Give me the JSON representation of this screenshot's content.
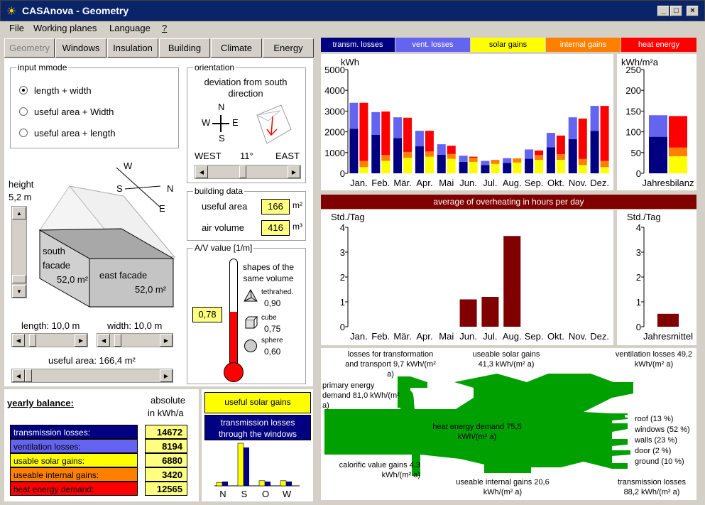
{
  "window": {
    "title": "CASAnova - Geometry",
    "min": "_",
    "max": "□",
    "close": "×"
  },
  "menu": [
    "File",
    "Working planes",
    "Language",
    "?"
  ],
  "tabs": [
    "Geometry",
    "Windows",
    "Insulation",
    "Building",
    "Climate",
    "Energy"
  ],
  "input_mode": {
    "title": "input mmode",
    "options": [
      "length + width",
      "useful area + Width",
      "useful area + length"
    ],
    "selected": 0
  },
  "orientation": {
    "title": "orientation",
    "desc": "deviation from south direction",
    "compass": {
      "n": "N",
      "w": "W",
      "e": "E",
      "s": "S"
    },
    "west": "WEST",
    "deg": "11°",
    "east": "EAST"
  },
  "building_data": {
    "title": "building data",
    "useful_area_label": "useful area",
    "useful_area": "166",
    "air_volume_label": "air volume",
    "air_volume": "416",
    "unit_area": "m²",
    "unit_volume": "m³"
  },
  "av": {
    "title": "A/V value [1/m]",
    "value": "0,78",
    "fill": 0.53,
    "shapes_label": "shapes of the same volume",
    "tetra": "tethrahed.",
    "tetra_v": "0,90",
    "cube": "cube",
    "cube_v": "0,75",
    "sphere": "sphere",
    "sphere_v": "0,60"
  },
  "geometry": {
    "height_label": "height",
    "height": "5,2 m",
    "south": "south",
    "facade": "facade",
    "south_area": "52,0 m²",
    "east": "east facade",
    "east_area": "52,0 m²",
    "compass": {
      "w": "W",
      "s": "S",
      "n": "N",
      "e": "E"
    },
    "length": "length: 10,0 m",
    "width": "width: 10,0 m",
    "useful_area": "useful area: 166,4 m²"
  },
  "yearly": {
    "title": "yearly balance:",
    "unit1": "absolute",
    "unit2": "in kWh/a",
    "rows": [
      {
        "label": "transmission losses:",
        "value": "14672",
        "color": "#000080",
        "text": "#ffffff"
      },
      {
        "label": "ventilation losses:",
        "value": "8194",
        "color": "#6464f0",
        "text": "#000000"
      },
      {
        "label": "usable solar gains:",
        "value": "6880",
        "color": "#ffff00",
        "text": "#000000"
      },
      {
        "label": "useable internal gains:",
        "value": "3420",
        "color": "#ff8000",
        "text": "#000000"
      },
      {
        "label": "heat energy demand:",
        "value": "12565",
        "color": "#ff0000",
        "text": "#000000"
      }
    ]
  },
  "windows_chart": {
    "solar_label": "useful solar gains",
    "trans_label": "transmission losses through the windows",
    "labels": [
      "N",
      "S",
      "O",
      "W"
    ],
    "solar": [
      0.08,
      1.0,
      0.12,
      0.12
    ],
    "trans": [
      0.1,
      0.9,
      0.1,
      0.1
    ]
  },
  "legend": [
    {
      "label": "transm. losses",
      "color": "#000080",
      "text": "#ffffff"
    },
    {
      "label": "vent. losses",
      "color": "#6464f0",
      "text": "#ffffff"
    },
    {
      "label": "solar gains",
      "color": "#ffff00",
      "text": "#000000"
    },
    {
      "label": "internal gains",
      "color": "#ff8000",
      "text": "#ffffff"
    },
    {
      "label": "heat energy",
      "color": "#ff0000",
      "text": "#ffffff"
    }
  ],
  "chart_data": [
    {
      "type": "bar",
      "title": "",
      "ylabel": "kWh",
      "ylim": [
        0,
        5000
      ],
      "yticks": [
        0,
        1000,
        2000,
        3000,
        4000,
        5000
      ],
      "categories": [
        "Jan.",
        "Feb.",
        "Mär.",
        "Apr.",
        "Mai",
        "Jun.",
        "Jul.",
        "Aug.",
        "Sep.",
        "Okt.",
        "Nov.",
        "Dez."
      ],
      "series": [
        {
          "name": "transm. losses",
          "values": [
            2150,
            1850,
            1700,
            1300,
            900,
            550,
            400,
            500,
            700,
            1250,
            1650,
            2050
          ]
        },
        {
          "name": "vent. losses",
          "values": [
            1250,
            1100,
            1000,
            750,
            500,
            300,
            200,
            230,
            450,
            700,
            1050,
            1200
          ]
        },
        {
          "name": "solar gains",
          "values": [
            300,
            600,
            750,
            800,
            700,
            550,
            450,
            520,
            650,
            650,
            400,
            300
          ]
        },
        {
          "name": "internal gains",
          "values": [
            300,
            280,
            280,
            250,
            230,
            200,
            200,
            200,
            230,
            270,
            290,
            300
          ]
        },
        {
          "name": "heat energy",
          "values": [
            2800,
            2100,
            1650,
            1000,
            400,
            50,
            0,
            0,
            220,
            900,
            1950,
            2650
          ]
        }
      ]
    },
    {
      "type": "bar",
      "title": "",
      "ylabel": "kWh/m²a",
      "ylim": [
        0,
        250
      ],
      "yticks": [
        0,
        50,
        100,
        150,
        200,
        250
      ],
      "categories": [
        "Jahresbilanz"
      ],
      "series": [
        {
          "name": "transm. losses",
          "values": [
            88
          ]
        },
        {
          "name": "vent. losses",
          "values": [
            52
          ]
        },
        {
          "name": "solar gains",
          "values": [
            41
          ]
        },
        {
          "name": "internal gains",
          "values": [
            21
          ]
        },
        {
          "name": "heat energy",
          "values": [
            76
          ]
        }
      ]
    },
    {
      "type": "bar",
      "title": "average of overheating in hours per day",
      "ylabel": "Std./Tag",
      "ylim": [
        0,
        4
      ],
      "yticks": [
        0,
        1,
        2,
        3,
        4
      ],
      "categories": [
        "Jan.",
        "Feb.",
        "Mär.",
        "Apr.",
        "Mai",
        "Jun.",
        "Jul.",
        "Aug.",
        "Sep.",
        "Okt.",
        "Nov.",
        "Dez."
      ],
      "series": [
        {
          "name": "",
          "values": [
            0,
            0,
            0,
            0,
            0,
            1.1,
            1.2,
            3.65,
            0,
            0,
            0,
            0
          ]
        }
      ]
    },
    {
      "type": "bar",
      "title": "",
      "ylabel": "Std./Tag",
      "ylim": [
        0,
        4
      ],
      "yticks": [
        0,
        1,
        2,
        3,
        4
      ],
      "categories": [
        "Jahresmittel"
      ],
      "series": [
        {
          "name": "",
          "values": [
            0.52
          ]
        }
      ]
    }
  ],
  "sankey": {
    "losses_transport": "losses for transformation and transport 9,7 kWh/(m² a)",
    "solar": "useable solar gains 41,3 kWh/(m² a)",
    "ventilation": "ventilation losses 49,2 kWh/(m² a)",
    "primary": "primary energy demand 81,0 kWh/(m² a)",
    "heat": "heat energy demand 75,5 kWh/(m² a)",
    "roof": "roof (13 %)",
    "windows": "windows (52 %)",
    "walls": "walls (23 %)",
    "door": "door (2 %)",
    "ground": "ground (10 %)",
    "calorific": "calorific value gains 4,3 kWh/(m² a)",
    "internal": "useable internal gains 20,6 kWh/(m² a)",
    "transmission": "transmission losses 88,2 kWh/(m² a)",
    "color": "#00a000"
  }
}
